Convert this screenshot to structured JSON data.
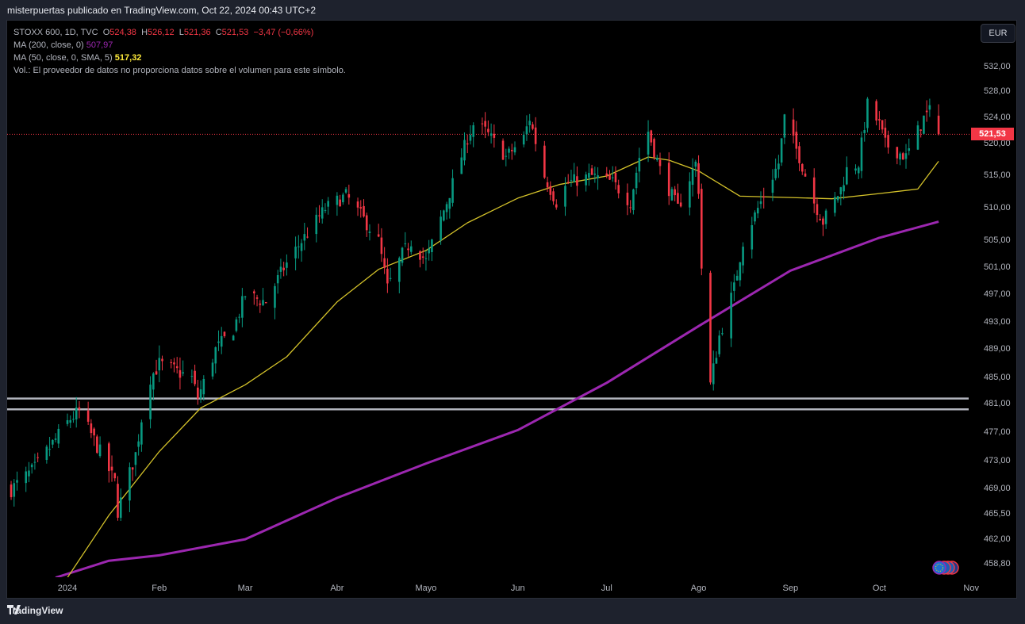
{
  "header": {
    "publisher": "misterpuertas publicado en TradingView.com, Oct 22, 2024 00:43 UTC+2"
  },
  "legend": {
    "symbol": "STOXX 600, 1D, TVC",
    "open_label": "O",
    "open": "524,38",
    "high_label": "H",
    "high": "526,12",
    "low_label": "L",
    "low": "521,36",
    "close_label": "C",
    "close": "521,53",
    "change": "−3,47 (−0,66%)",
    "ma200_label": "MA (200, close, 0)",
    "ma200_value": "507,97",
    "ma50_label": "MA (50, close, 0, SMA, 5)",
    "ma50_value": "517,32",
    "volume_note": "Vol.: El proveedor de datos no proporciona datos sobre el volumen para este símbolo."
  },
  "currency_button": "EUR",
  "last_price_tag": "521,53",
  "footer": {
    "brand": "TradingView"
  },
  "colors": {
    "up": "#089981",
    "down": "#f23645",
    "ma200": "#9c27b0",
    "ma50": "#d4c22a",
    "levels": "#b2b5be"
  },
  "chart_data": {
    "type": "candlestick",
    "title": "STOXX 600, 1D, TVC",
    "y_scale": "price (EUR)",
    "y_ticks": [
      {
        "label": "532,00",
        "v": 532
      },
      {
        "label": "528,00",
        "v": 528
      },
      {
        "label": "524,00",
        "v": 524
      },
      {
        "label": "520,00",
        "v": 520
      },
      {
        "label": "515,00",
        "v": 515
      },
      {
        "label": "510,00",
        "v": 510
      },
      {
        "label": "505,00",
        "v": 505
      },
      {
        "label": "501,00",
        "v": 501
      },
      {
        "label": "497,00",
        "v": 497
      },
      {
        "label": "493,00",
        "v": 493
      },
      {
        "label": "489,00",
        "v": 489
      },
      {
        "label": "485,00",
        "v": 485
      },
      {
        "label": "481,00",
        "v": 481
      },
      {
        "label": "477,00",
        "v": 477
      },
      {
        "label": "473,00",
        "v": 473
      },
      {
        "label": "469,00",
        "v": 469
      },
      {
        "label": "465,50",
        "v": 465.5
      },
      {
        "label": "462,00",
        "v": 462
      },
      {
        "label": "458,80",
        "v": 458.8
      }
    ],
    "x_ticks": [
      {
        "label": "2024",
        "date": "2024-01-01"
      },
      {
        "label": "Feb",
        "date": "2024-02-01"
      },
      {
        "label": "Mar",
        "date": "2024-03-01"
      },
      {
        "label": "Abr",
        "date": "2024-04-01"
      },
      {
        "label": "Mayo",
        "date": "2024-05-01"
      },
      {
        "label": "Jun",
        "date": "2024-06-01"
      },
      {
        "label": "Jul",
        "date": "2024-07-01"
      },
      {
        "label": "Ago",
        "date": "2024-08-01"
      },
      {
        "label": "Sep",
        "date": "2024-09-01"
      },
      {
        "label": "Oct",
        "date": "2024-10-01"
      },
      {
        "label": "Nov",
        "date": "2024-11-01"
      }
    ],
    "approx_close_path": [
      [
        "2023-12-13",
        469
      ],
      [
        "2023-12-21",
        472
      ],
      [
        "2024-01-02",
        479
      ],
      [
        "2024-01-05",
        480
      ],
      [
        "2024-01-10",
        476
      ],
      [
        "2024-01-17",
        470
      ],
      [
        "2024-01-18",
        466
      ],
      [
        "2024-01-24",
        474
      ],
      [
        "2024-01-26",
        479
      ],
      [
        "2024-01-29",
        485
      ],
      [
        "2024-02-01",
        487
      ],
      [
        "2024-02-12",
        485
      ],
      [
        "2024-02-14",
        482
      ],
      [
        "2024-02-20",
        489
      ],
      [
        "2024-02-26",
        492
      ],
      [
        "2024-03-01",
        497
      ],
      [
        "2024-03-08",
        496
      ],
      [
        "2024-03-14",
        501
      ],
      [
        "2024-03-20",
        505
      ],
      [
        "2024-03-28",
        510
      ],
      [
        "2024-04-04",
        512
      ],
      [
        "2024-04-09",
        509
      ],
      [
        "2024-04-15",
        505
      ],
      [
        "2024-04-18",
        498
      ],
      [
        "2024-04-23",
        503
      ],
      [
        "2024-04-26",
        505
      ],
      [
        "2024-05-01",
        502
      ],
      [
        "2024-05-08",
        511
      ],
      [
        "2024-05-15",
        521
      ],
      [
        "2024-05-17",
        523
      ],
      [
        "2024-05-21",
        522
      ],
      [
        "2024-05-28",
        518
      ],
      [
        "2024-06-03",
        521
      ],
      [
        "2024-06-05",
        524
      ],
      [
        "2024-06-10",
        515
      ],
      [
        "2024-06-14",
        511
      ],
      [
        "2024-06-18",
        514
      ],
      [
        "2024-06-26",
        515
      ],
      [
        "2024-07-03",
        514
      ],
      [
        "2024-07-09",
        511
      ],
      [
        "2024-07-12",
        518
      ],
      [
        "2024-07-15",
        522
      ],
      [
        "2024-07-19",
        516
      ],
      [
        "2024-07-25",
        510
      ],
      [
        "2024-07-31",
        517
      ],
      [
        "2024-08-01",
        513
      ],
      [
        "2024-08-02",
        501
      ],
      [
        "2024-08-05",
        484
      ],
      [
        "2024-08-08",
        491
      ],
      [
        "2024-08-13",
        498
      ],
      [
        "2024-08-16",
        505
      ],
      [
        "2024-08-23",
        512
      ],
      [
        "2024-08-28",
        517
      ],
      [
        "2024-08-30",
        524
      ],
      [
        "2024-09-04",
        518
      ],
      [
        "2024-09-09",
        511
      ],
      [
        "2024-09-12",
        508
      ],
      [
        "2024-09-18",
        513
      ],
      [
        "2024-09-20",
        516
      ],
      [
        "2024-09-24",
        517
      ],
      [
        "2024-09-27",
        526
      ],
      [
        "2024-10-01",
        523
      ],
      [
        "2024-10-03",
        520
      ],
      [
        "2024-10-10",
        518
      ],
      [
        "2024-10-14",
        522
      ],
      [
        "2024-10-16",
        524
      ],
      [
        "2024-10-18",
        525
      ],
      [
        "2024-10-21",
        521.53
      ]
    ],
    "last_candle": {
      "date": "2024-10-21",
      "open": 524.38,
      "high": 526.12,
      "low": 521.36,
      "close": 521.53
    },
    "ma200": [
      [
        "2023-12-28",
        457.1
      ],
      [
        "2024-01-15",
        459.3
      ],
      [
        "2024-02-01",
        460
      ],
      [
        "2024-03-01",
        462.1
      ],
      [
        "2024-04-01",
        467.8
      ],
      [
        "2024-05-01",
        472.7
      ],
      [
        "2024-06-01",
        477.4
      ],
      [
        "2024-07-01",
        484.3
      ],
      [
        "2024-08-01",
        492.5
      ],
      [
        "2024-09-01",
        500.6
      ],
      [
        "2024-10-01",
        505.5
      ],
      [
        "2024-10-21",
        507.97
      ]
    ],
    "ma50": [
      [
        "2024-01-01",
        457.1
      ],
      [
        "2024-01-15",
        465.4
      ],
      [
        "2024-02-01",
        474.4
      ],
      [
        "2024-02-15",
        480.5
      ],
      [
        "2024-03-01",
        484
      ],
      [
        "2024-03-15",
        488
      ],
      [
        "2024-04-01",
        496
      ],
      [
        "2024-04-15",
        500.8
      ],
      [
        "2024-05-01",
        503.6
      ],
      [
        "2024-05-15",
        507.8
      ],
      [
        "2024-06-01",
        511.6
      ],
      [
        "2024-06-15",
        513.7
      ],
      [
        "2024-07-01",
        515
      ],
      [
        "2024-07-15",
        518
      ],
      [
        "2024-07-22",
        517.5
      ],
      [
        "2024-08-01",
        515.8
      ],
      [
        "2024-08-15",
        511.9
      ],
      [
        "2024-09-01",
        511.7
      ],
      [
        "2024-09-15",
        511.5
      ],
      [
        "2024-10-01",
        512.3
      ],
      [
        "2024-10-14",
        513
      ],
      [
        "2024-10-21",
        517.32
      ]
    ],
    "horizontal_levels": [
      481.9,
      480.3
    ]
  }
}
